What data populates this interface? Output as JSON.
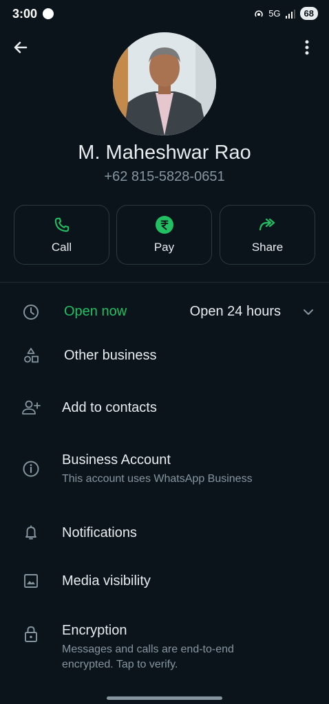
{
  "status_bar": {
    "time": "3:00",
    "network": "5G",
    "battery": "68"
  },
  "contact": {
    "name": "M. Maheshwar Rao",
    "phone": "+62 815-5828-0651"
  },
  "actions": [
    {
      "label": "Call",
      "icon": "phone-icon"
    },
    {
      "label": "Pay",
      "icon": "rupee-icon"
    },
    {
      "label": "Share",
      "icon": "forward-icon"
    }
  ],
  "hours": {
    "status": "Open now",
    "value": "Open 24 hours"
  },
  "rows": {
    "other_business": {
      "title": "Other business"
    },
    "add_contacts": {
      "title": "Add to contacts"
    },
    "business_account": {
      "title": "Business Account",
      "subtitle": "This account uses WhatsApp Business"
    },
    "notifications": {
      "title": "Notifications"
    },
    "media_visibility": {
      "title": "Media visibility"
    },
    "encryption": {
      "title": "Encryption",
      "subtitle_line1": "Messages and calls are end-to-end",
      "subtitle_line2": "encrypted. Tap to verify."
    }
  },
  "colors": {
    "background": "#0b141a",
    "accent": "#21c063",
    "text": "#e9edef",
    "muted": "#8696a0"
  }
}
